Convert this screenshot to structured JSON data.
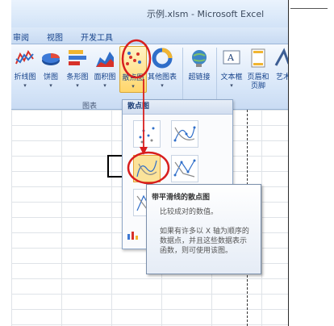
{
  "window": {
    "title": "示例.xlsm - Microsoft Excel"
  },
  "tabs": [
    {
      "label": "审阅"
    },
    {
      "label": "视图"
    },
    {
      "label": "开发工具"
    }
  ],
  "ribbon": {
    "buttons": [
      {
        "label": "折线图",
        "icon": "line-chart-icon"
      },
      {
        "label": "饼图",
        "icon": "pie-chart-icon"
      },
      {
        "label": "条形图",
        "icon": "bar-chart-icon"
      },
      {
        "label": "面积图",
        "icon": "area-chart-icon"
      },
      {
        "label": "散点图",
        "icon": "scatter-chart-icon"
      },
      {
        "label": "其他图表",
        "icon": "other-chart-icon"
      },
      {
        "label": "超链接",
        "icon": "hyperlink-icon"
      },
      {
        "label": "文本框",
        "icon": "textbox-icon"
      },
      {
        "label": "页眉和",
        "label2": "页脚",
        "icon": "header-footer-icon"
      },
      {
        "label": "艺术",
        "icon": "wordart-icon"
      }
    ],
    "group_label": "图表",
    "dropdown_arrow": "▾"
  },
  "dropdown": {
    "title": "散点图",
    "items": [
      {
        "name": "scatter-markers-only",
        "icon": "scatter-markers-icon"
      },
      {
        "name": "scatter-smooth-lines-markers",
        "icon": "scatter-smooth-markers-icon"
      },
      {
        "name": "scatter-smooth-lines",
        "icon": "scatter-smooth-icon",
        "selected": true
      },
      {
        "name": "scatter-straight-lines-markers",
        "icon": "scatter-straight-markers-icon"
      },
      {
        "name": "scatter-straight-lines",
        "icon": "scatter-straight-icon"
      }
    ],
    "all_chart_types_icon": "all-chart-types-icon"
  },
  "tooltip": {
    "title": "带平滑线的散点图",
    "line1": "比较成对的数值。",
    "line2": "如果有许多以 X 轴为顺序的",
    "line3": "数据点，并且这些数据表示",
    "line4": "函数，则可使用该图。"
  },
  "colors": {
    "highlight_red": "#d81e1e",
    "selected_fill": "#fbe39a",
    "ribbon_text": "#15428b"
  }
}
